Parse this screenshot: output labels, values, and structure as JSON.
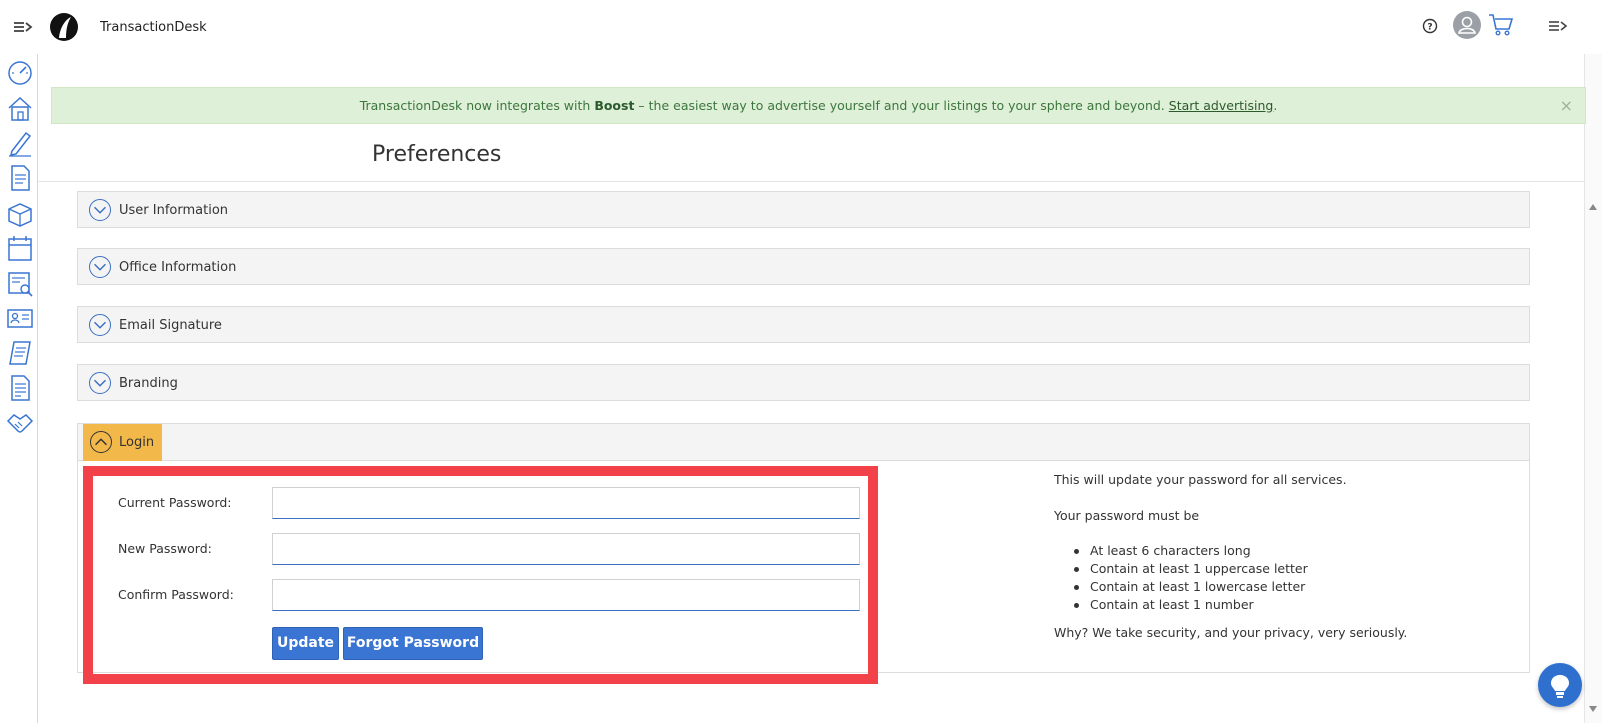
{
  "header": {
    "app_title": "TransactionDesk"
  },
  "banner": {
    "text_prefix": "TransactionDesk now integrates with",
    "brand": "Boost",
    "text_suffix": "– the easiest way to advertise yourself and your listings to your sphere and beyond.",
    "link": "Start advertising",
    "end": ".",
    "close": "×"
  },
  "page": {
    "title": "Preferences"
  },
  "sections": [
    {
      "label": "User Information"
    },
    {
      "label": "Office Information"
    },
    {
      "label": "Email Signature"
    },
    {
      "label": "Branding"
    },
    {
      "label": "Login"
    }
  ],
  "login": {
    "current_label": "Current Password:",
    "new_label": "New Password:",
    "confirm_label": "Confirm Password:",
    "current_value": "",
    "new_value": "",
    "confirm_value": "",
    "update_button": "Update",
    "forgot_button": "Forgot Password",
    "info_line": "This will update your password for all services.",
    "must_be": "Your password must be",
    "rules": [
      "At least 6 characters long",
      "Contain at least 1 uppercase letter",
      "Contain at least 1 lowercase letter",
      "Contain at least 1 number"
    ],
    "why": "Why? We take security, and your privacy, very seriously."
  },
  "colors": {
    "accent": "#3a75d4",
    "active_tab": "#f2b94a",
    "highlight": "#f24148",
    "banner_bg": "#dff0d8"
  },
  "icons": {
    "sidebar": [
      "dashboard-icon",
      "home-icon",
      "pen-icon",
      "document-icon",
      "box-icon",
      "calendar-icon",
      "search-list-icon",
      "contact-card-icon",
      "scroll-icon",
      "form-icon",
      "handshake-icon"
    ]
  }
}
